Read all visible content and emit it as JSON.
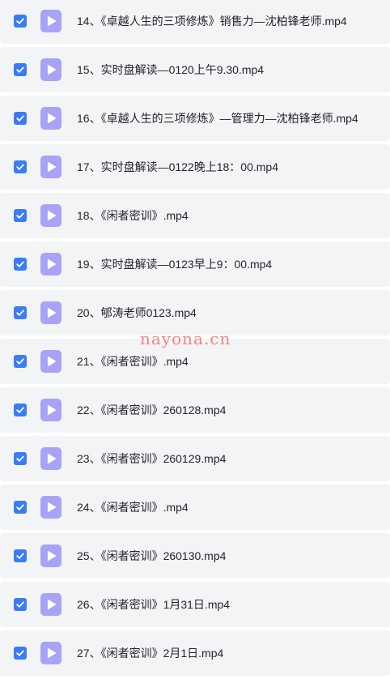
{
  "colors": {
    "row_background": "#f3f4f6",
    "checkbox_checked": "#3a7cf6",
    "video_icon": "#a7a3f5",
    "watermark": "#f0716f"
  },
  "files": [
    {
      "name": "14、《卓越人生的三项修炼》销售力—沈柏锋老师.mp4",
      "checked": true,
      "icon": "video-file-icon"
    },
    {
      "name": "15、实时盘解读—0120上午9.30.mp4",
      "checked": true,
      "icon": "video-file-icon"
    },
    {
      "name": "16、《卓越人生的三项修炼》—管理力—沈柏锋老师.mp4",
      "checked": true,
      "icon": "video-file-icon"
    },
    {
      "name": "17、实时盘解读—0122晚上18：00.mp4",
      "checked": true,
      "icon": "video-file-icon"
    },
    {
      "name": "18、《闲者密训》.mp4",
      "checked": true,
      "icon": "video-file-icon"
    },
    {
      "name": "19、实时盘解读—0123早上9：00.mp4",
      "checked": true,
      "icon": "video-file-icon"
    },
    {
      "name": "20、郇涛老师0123.mp4",
      "checked": true,
      "icon": "video-file-icon"
    },
    {
      "name": "21、《闲者密训》.mp4",
      "checked": true,
      "icon": "video-file-icon"
    },
    {
      "name": "22、《闲者密训》260128.mp4",
      "checked": true,
      "icon": "video-file-icon"
    },
    {
      "name": "23、《闲者密训》260129.mp4",
      "checked": true,
      "icon": "video-file-icon"
    },
    {
      "name": "24、《闲者密训》.mp4",
      "checked": true,
      "icon": "video-file-icon"
    },
    {
      "name": "25、《闲者密训》260130.mp4",
      "checked": true,
      "icon": "video-file-icon"
    },
    {
      "name": "26、《闲者密训》1月31日.mp4",
      "checked": true,
      "icon": "video-file-icon"
    },
    {
      "name": "27、《闲者密训》2月1日.mp4",
      "checked": true,
      "icon": "video-file-icon"
    }
  ],
  "watermark": {
    "text": "nayona.cn"
  }
}
